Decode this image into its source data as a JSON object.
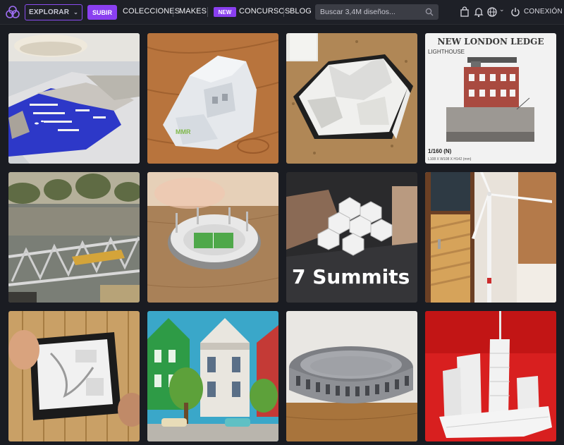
{
  "nav": {
    "explore_label": "EXPLORAR",
    "upload_label": "SUBIR",
    "links": {
      "collections": "COLECCIONES",
      "makes": "MAKES",
      "contests": "CONCURSOS",
      "blog": "BLOG"
    },
    "new_badge": "NEW",
    "search_placeholder": "Buscar 3,4M diseños...",
    "login_label": "CONEXIÓN",
    "accent_color": "#8a3ff0"
  },
  "tiles": [
    {
      "subject": "harbor-map-model"
    },
    {
      "subject": "mountain-house-model",
      "watermark": "MMR"
    },
    {
      "subject": "terrain-relief-model"
    },
    {
      "subject": "lighthouse-model",
      "title": "NEW LONDON LEDGE",
      "subtitle": "LIGHTHOUSE",
      "scale": "1/160 (N)",
      "dims": "L108 X W108 X H142 (mm)"
    },
    {
      "subject": "railway-bridge-model"
    },
    {
      "subject": "stadium-model"
    },
    {
      "subject": "seven-summits-model",
      "caption": "7 Summits"
    },
    {
      "subject": "wind-turbine-model"
    },
    {
      "subject": "relief-tablet-model"
    },
    {
      "subject": "victorian-houses-model"
    },
    {
      "subject": "colosseum-model"
    },
    {
      "subject": "skyscrapers-model"
    }
  ]
}
